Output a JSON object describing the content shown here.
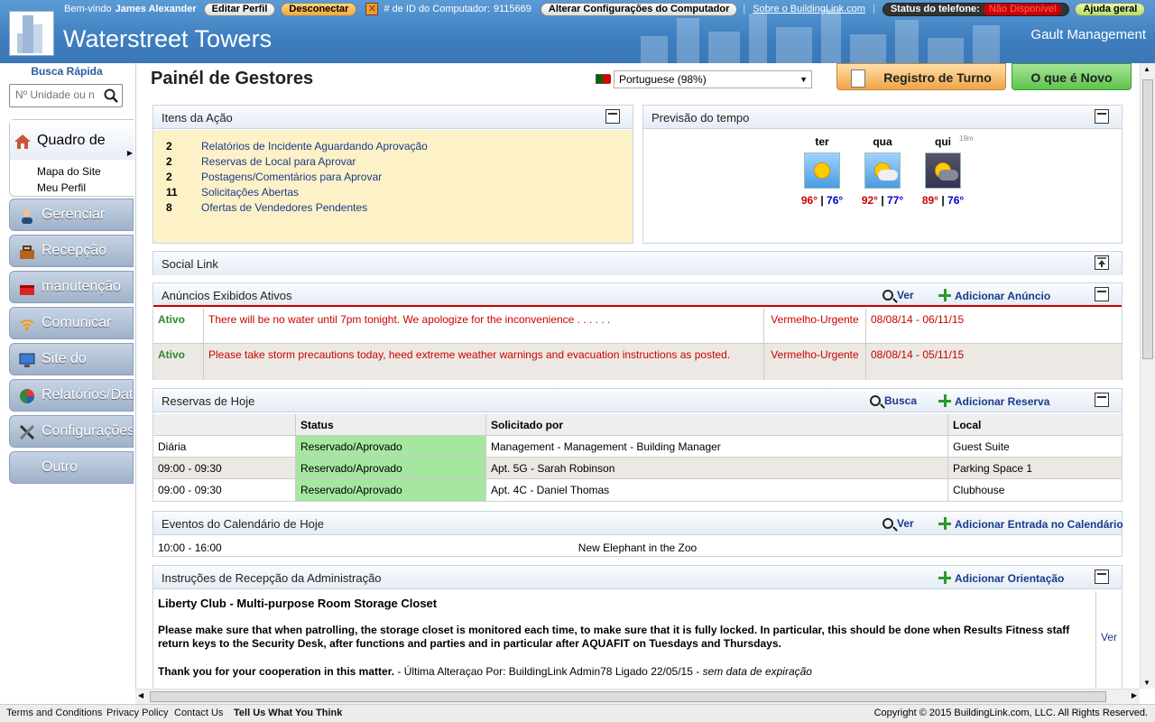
{
  "header": {
    "welcome": "Bem-vindo",
    "user_name": "James Alexander",
    "edit_profile": "Editar Perfil",
    "logout": "Desconectar",
    "computer_id_label": "# de ID do Computador:",
    "computer_id": "9115669",
    "computer_settings": "Alterar Configurações do Computador",
    "about": "Sobre o BuildingLink.com",
    "phone_status_label": "Status do telefone:",
    "phone_status_value": "Não Disponível",
    "help": "Ajuda geral",
    "building_name": "Waterstreet Towers",
    "management": "Gault Management"
  },
  "sidebar": {
    "quick_search_title": "Busca Rápida",
    "quick_search_placeholder": "Nº Unidade ou n",
    "active": {
      "label": "Quadro de",
      "sub": [
        "Mapa do Site",
        "Meu Perfil"
      ]
    },
    "items": [
      {
        "label": "Gerenciar",
        "icon": "user-icon"
      },
      {
        "label": "Recepção",
        "icon": "toolbox-icon"
      },
      {
        "label": "manutenção",
        "icon": "toolbox-red-icon"
      },
      {
        "label": "Comunicar",
        "icon": "wifi-icon"
      },
      {
        "label": "Site do",
        "icon": "monitor-icon"
      },
      {
        "label": "Relatórios/Dat",
        "icon": "pie-chart-icon"
      },
      {
        "label": "Configurações",
        "icon": "tools-icon"
      },
      {
        "label": "Outro",
        "icon": ""
      }
    ]
  },
  "main": {
    "title": "Painél de Gestores",
    "language": "Portuguese (98%)",
    "shift_log": "Registro de Turno",
    "whats_new": "O que é Novo"
  },
  "action_items": {
    "title": "Itens da Ação",
    "rows": [
      {
        "count": "2",
        "label": "Relatórios de Incidente Aguardando Aprovação"
      },
      {
        "count": "2",
        "label": "Reservas de Local para Aprovar"
      },
      {
        "count": "2",
        "label": "Postagens/Comentários para Aprovar"
      },
      {
        "count": "11",
        "label": "Solicitações Abertas"
      },
      {
        "count": "8",
        "label": "Ofertas de Vendedores Pendentes"
      }
    ]
  },
  "weather": {
    "title": "Previsão do tempo",
    "updated": "19m",
    "days": [
      {
        "day": "ter",
        "high": "96°",
        "low": "76°",
        "icon": "sunny-icon"
      },
      {
        "day": "qua",
        "high": "92°",
        "low": "77°",
        "icon": "partly-cloudy-icon"
      },
      {
        "day": "qui",
        "high": "89°",
        "low": "76°",
        "icon": "storm-icon"
      }
    ]
  },
  "social_link": {
    "title": "Social Link"
  },
  "announcements": {
    "title": "Anúncios Exibidos Ativos",
    "view": "Ver",
    "add": "Adicionar Anúncio",
    "rows": [
      {
        "status": "Ativo",
        "text": "There will be no water until 7pm tonight. We apologize for the inconvenience . . . . . .",
        "priority": "Vermelho-Urgente",
        "dates": "08/08/14 - 06/11/15"
      },
      {
        "status": "Ativo",
        "text": "Please take storm precautions today, heed extreme weather warnings and evacuation instructions as posted.",
        "priority": "Vermelho-Urgente",
        "dates": "08/08/14 - 05/11/15"
      }
    ]
  },
  "reservations": {
    "title": "Reservas de Hoje",
    "search": "Busca",
    "add": "Adicionar Reserva",
    "columns": [
      "",
      "Status",
      "Solicitado por",
      "Local"
    ],
    "rows": [
      {
        "time": "Diária",
        "status": "Reservado/Aprovado",
        "by": "Management - Management - Building Manager",
        "place": "Guest Suite"
      },
      {
        "time": "09:00 - 09:30",
        "status": "Reservado/Aprovado",
        "by": "Apt. 5G - Sarah Robinson",
        "place": "Parking Space 1"
      },
      {
        "time": "09:00 - 09:30",
        "status": "Reservado/Aprovado",
        "by": "Apt. 4C - Daniel Thomas",
        "place": "Clubhouse"
      }
    ]
  },
  "calendar": {
    "title": "Eventos do Calendário de Hoje",
    "view": "Ver",
    "add": "Adicionar Entrada no Calendário",
    "rows": [
      {
        "time": "10:00 - 16:00",
        "event": "New Elephant in the Zoo"
      }
    ]
  },
  "instructions": {
    "title": "Instruções de Recepção da Administração",
    "add": "Adicionar Orientação",
    "item_title": "Liberty Club - Multi-purpose Room Storage Closet",
    "body": "Please make sure that when patrolling, the storage closet is monitored each time, to make sure that it is fully locked. In particular, this should be done when Results Fitness staff return keys to the Security Desk, after functions and parties and in particular after AQUAFIT on Tuesdays and Thursdays.",
    "thanks": "Thank you for your cooperation in this matter.",
    "meta": " - Última Alteraçao Por: BuildingLink Admin78 Ligado 22/05/15 - ",
    "expiry": "sem data de expiração",
    "view": "Ver"
  },
  "footer": {
    "terms": "Terms and Conditions",
    "privacy": "Privacy Policy",
    "contact": "Contact Us",
    "feedback": "Tell Us What You Think",
    "copyright": "Copyright © 2015 BuildingLink.com, LLC.   All Rights Reserved."
  }
}
